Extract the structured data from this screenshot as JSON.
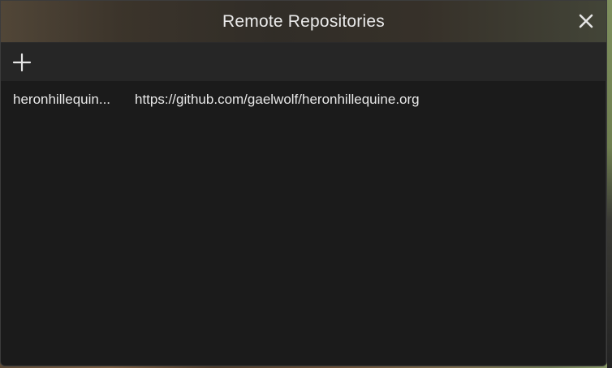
{
  "window": {
    "title": "Remote Repositories"
  },
  "toolbar": {
    "add_icon": "plus-icon"
  },
  "icons": {
    "close": "close-icon"
  },
  "remotes": [
    {
      "name": "heronhillequin...",
      "url": "https://github.com/gaelwolf/heronhillequine.org"
    }
  ],
  "colors": {
    "dialog_bg": "#1b1b1b",
    "toolbar_bg": "#262626",
    "text": "#e8e8e8"
  }
}
